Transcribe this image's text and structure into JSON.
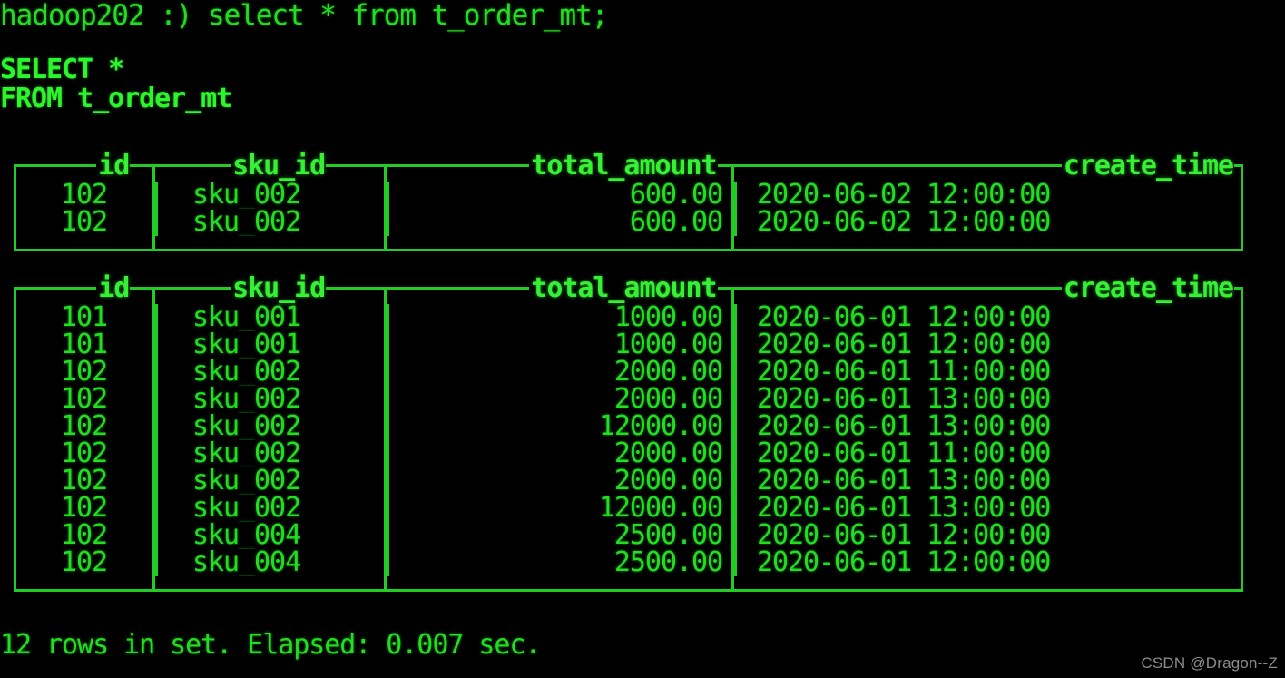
{
  "terminal": {
    "prompt_line": "hadoop202 :) select * from t_order_mt;",
    "echo_select": "SELECT *",
    "echo_from": "FROM t_order_mt",
    "footer": "12 rows in set. Elapsed: 0.007 sec.",
    "foreground_color": "#22dd22",
    "background_color": "#000000",
    "border_color": "#22cc22"
  },
  "watermark": {
    "text": "CSDN @Dragon--Z",
    "color": "#8c8c8c"
  },
  "result_blocks": [
    {
      "columns": [
        "id",
        "sku_id",
        "total_amount",
        "create_time"
      ],
      "rows": [
        [
          "102",
          "sku_002",
          "600.00",
          "2020-06-02 12:00:00"
        ],
        [
          "102",
          "sku_002",
          "600.00",
          "2020-06-02 12:00:00"
        ]
      ]
    },
    {
      "columns": [
        "id",
        "sku_id",
        "total_amount",
        "create_time"
      ],
      "rows": [
        [
          "101",
          "sku_001",
          "1000.00",
          "2020-06-01 12:00:00"
        ],
        [
          "101",
          "sku_001",
          "1000.00",
          "2020-06-01 12:00:00"
        ],
        [
          "102",
          "sku_002",
          "2000.00",
          "2020-06-01 11:00:00"
        ],
        [
          "102",
          "sku_002",
          "2000.00",
          "2020-06-01 13:00:00"
        ],
        [
          "102",
          "sku_002",
          "12000.00",
          "2020-06-01 13:00:00"
        ],
        [
          "102",
          "sku_002",
          "2000.00",
          "2020-06-01 11:00:00"
        ],
        [
          "102",
          "sku_002",
          "2000.00",
          "2020-06-01 13:00:00"
        ],
        [
          "102",
          "sku_002",
          "12000.00",
          "2020-06-01 13:00:00"
        ],
        [
          "102",
          "sku_004",
          "2500.00",
          "2020-06-01 12:00:00"
        ],
        [
          "102",
          "sku_004",
          "2500.00",
          "2020-06-01 12:00:00"
        ]
      ]
    }
  ]
}
